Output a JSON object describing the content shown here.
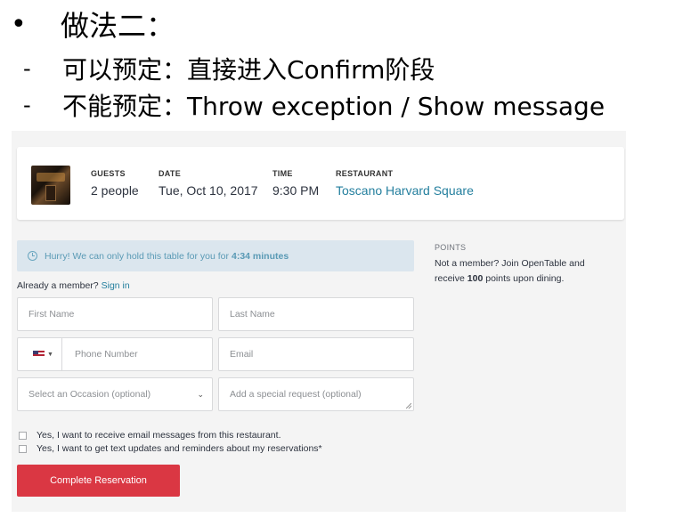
{
  "slide": {
    "bullet_main": "做法二：",
    "bullet_main_marker": "•",
    "sub1_marker": "-",
    "sub1_text": "可以预定：直接进入Confirm阶段",
    "sub2_marker": "-",
    "sub2_text": "不能预定：Throw exception / Show message"
  },
  "reservation": {
    "guests_label": "GUESTS",
    "guests_value": "2 people",
    "date_label": "DATE",
    "date_value": "Tue, Oct 10, 2017",
    "time_label": "TIME",
    "time_value": "9:30 PM",
    "restaurant_label": "RESTAURANT",
    "restaurant_value": "Toscano Harvard Square"
  },
  "hurry": {
    "text": "Hurry! We can only hold this table for you for",
    "timer": "4:34 minutes"
  },
  "signin": {
    "prompt": "Already a member?",
    "link": "Sign in"
  },
  "form": {
    "first_name_placeholder": "First Name",
    "last_name_placeholder": "Last Name",
    "phone_placeholder": "Phone Number",
    "email_placeholder": "Email",
    "occasion_placeholder": "Select an Occasion (optional)",
    "request_placeholder": "Add a special request (optional)",
    "checkbox_email": "Yes, I want to receive email messages from this restaurant.",
    "checkbox_text": "Yes, I want to get text updates and reminders about my reservations*",
    "submit_label": "Complete Reservation"
  },
  "points": {
    "heading": "POINTS",
    "text_before": "Not a member? Join OpenTable and receive",
    "amount": "100",
    "text_after": "points upon dining."
  },
  "colors": {
    "accent_link": "#247f9e",
    "cta": "#da3743",
    "alert_bg": "#dbe6ee"
  }
}
